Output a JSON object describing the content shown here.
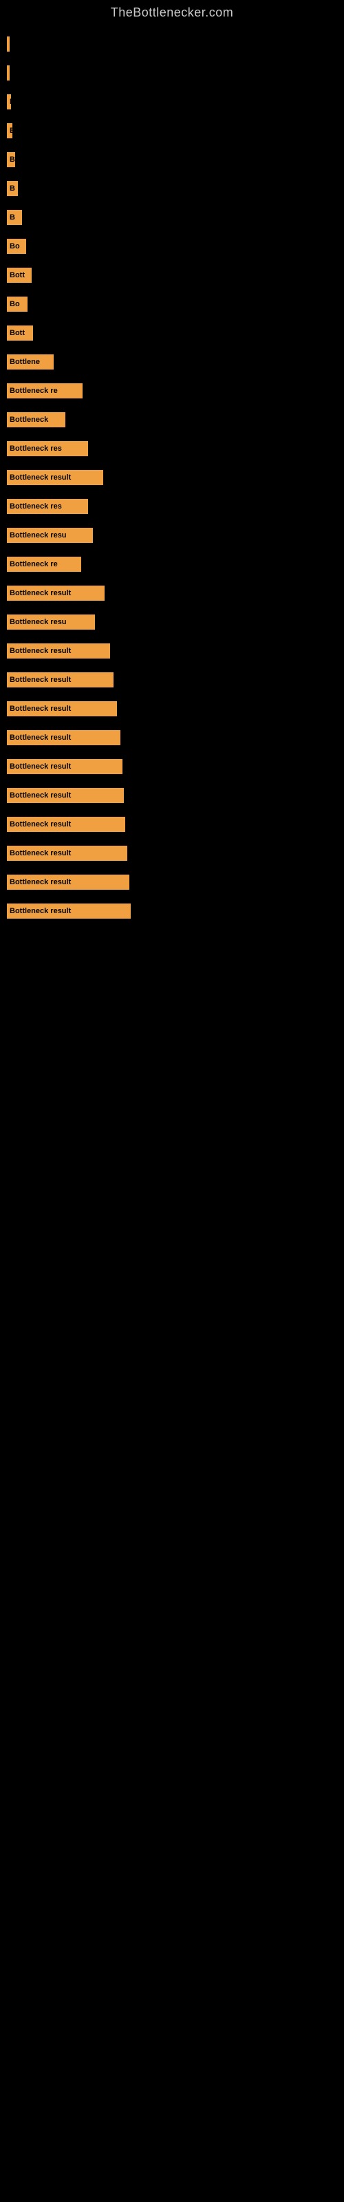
{
  "site": {
    "title": "TheBottlenecker.com"
  },
  "bars": [
    {
      "label": "",
      "width": 2
    },
    {
      "label": "",
      "width": 0,
      "gap": true
    },
    {
      "label": "B",
      "width": 4
    },
    {
      "label": "",
      "width": 0,
      "gap": true
    },
    {
      "label": "B",
      "width": 6
    },
    {
      "label": "",
      "width": 0,
      "gap": true
    },
    {
      "label": "B",
      "width": 8
    },
    {
      "label": "",
      "width": 0,
      "gap": true
    },
    {
      "label": "B",
      "width": 12
    },
    {
      "label": "",
      "width": 0,
      "gap": true
    },
    {
      "label": "B",
      "width": 16
    },
    {
      "label": "",
      "width": 0,
      "gap": true
    },
    {
      "label": "B",
      "width": 22
    },
    {
      "label": "",
      "width": 0,
      "gap": true
    },
    {
      "label": "Bo",
      "width": 28
    },
    {
      "label": "",
      "width": 0,
      "gap": true
    },
    {
      "label": "Bott",
      "width": 36
    },
    {
      "label": "",
      "width": 0,
      "gap": true
    },
    {
      "label": "Bo",
      "width": 30
    },
    {
      "label": "",
      "width": 0,
      "gap": true
    },
    {
      "label": "Bott",
      "width": 38
    },
    {
      "label": "",
      "width": 0,
      "gap": true
    },
    {
      "label": "Bottlene",
      "width": 68
    },
    {
      "label": "",
      "width": 0,
      "gap": true
    },
    {
      "label": "Bottleneck re",
      "width": 110
    },
    {
      "label": "",
      "width": 0,
      "gap": true
    },
    {
      "label": "Bottleneck",
      "width": 85
    },
    {
      "label": "",
      "width": 0,
      "gap": true
    },
    {
      "label": "Bottleneck res",
      "width": 118
    },
    {
      "label": "",
      "width": 0,
      "gap": true
    },
    {
      "label": "Bottleneck result",
      "width": 140
    },
    {
      "label": "",
      "width": 0,
      "gap": true
    },
    {
      "label": "Bottleneck res",
      "width": 118
    },
    {
      "label": "",
      "width": 0,
      "gap": true
    },
    {
      "label": "Bottleneck resu",
      "width": 125
    },
    {
      "label": "",
      "width": 0,
      "gap": true
    },
    {
      "label": "Bottleneck re",
      "width": 108
    },
    {
      "label": "",
      "width": 0,
      "gap": true
    },
    {
      "label": "Bottleneck result",
      "width": 142
    },
    {
      "label": "",
      "width": 0,
      "gap": true
    },
    {
      "label": "Bottleneck resu",
      "width": 128
    },
    {
      "label": "",
      "width": 0,
      "gap": true
    },
    {
      "label": "Bottleneck result",
      "width": 150
    },
    {
      "label": "",
      "width": 0,
      "gap": true
    },
    {
      "label": "Bottleneck result",
      "width": 155
    },
    {
      "label": "",
      "width": 0,
      "gap": true
    },
    {
      "label": "Bottleneck result",
      "width": 160
    },
    {
      "label": "",
      "width": 0,
      "gap": true
    },
    {
      "label": "Bottleneck result",
      "width": 165
    },
    {
      "label": "",
      "width": 0,
      "gap": true
    },
    {
      "label": "Bottleneck result",
      "width": 168
    },
    {
      "label": "",
      "width": 0,
      "gap": true
    },
    {
      "label": "Bottleneck result",
      "width": 170
    },
    {
      "label": "",
      "width": 0,
      "gap": true
    },
    {
      "label": "Bottleneck result",
      "width": 172
    },
    {
      "label": "",
      "width": 0,
      "gap": true
    },
    {
      "label": "Bottleneck result",
      "width": 175
    },
    {
      "label": "",
      "width": 0,
      "gap": true
    },
    {
      "label": "Bottleneck result",
      "width": 178
    },
    {
      "label": "",
      "width": 0,
      "gap": true
    },
    {
      "label": "Bottleneck result",
      "width": 180
    }
  ]
}
